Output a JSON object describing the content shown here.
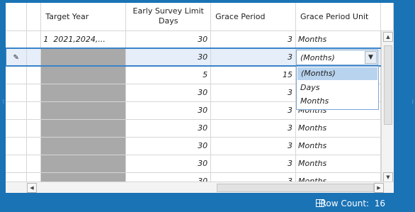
{
  "columns": {
    "target_year": "Target Year",
    "early_survey": "Early Survey Limit Days",
    "grace_period": "Grace Period",
    "grace_unit": "Grace Period Unit"
  },
  "rows": [
    {
      "idx": "1",
      "target_year": "2021,2024,...",
      "early": "30",
      "grace": "3",
      "unit": "Months"
    },
    {
      "idx": "",
      "target_year": "",
      "early": "30",
      "grace": "3",
      "unit": "(Months)",
      "editing": true
    },
    {
      "idx": "",
      "target_year": "",
      "early": "5",
      "grace": "15",
      "unit": ""
    },
    {
      "idx": "",
      "target_year": "",
      "early": "30",
      "grace": "3",
      "unit": ""
    },
    {
      "idx": "",
      "target_year": "",
      "early": "30",
      "grace": "3",
      "unit": "Months"
    },
    {
      "idx": "",
      "target_year": "",
      "early": "30",
      "grace": "3",
      "unit": "Months"
    },
    {
      "idx": "",
      "target_year": "",
      "early": "30",
      "grace": "3",
      "unit": "Months"
    },
    {
      "idx": "",
      "target_year": "",
      "early": "30",
      "grace": "3",
      "unit": "Months"
    },
    {
      "idx": "",
      "target_year": "",
      "early": "30",
      "grace": "3",
      "unit": "Months"
    }
  ],
  "editor": {
    "value": "(Months)"
  },
  "dropdown": {
    "options": [
      "(Months)",
      "Days",
      "Months"
    ],
    "selected": 0
  },
  "status": {
    "row_count_label": "Row Count:",
    "row_count": "16"
  },
  "icons": {
    "edit_indicator": "pencil-icon",
    "row_count": "table-icon"
  },
  "colors": {
    "accent": "#1a73b5",
    "selection": "#e5eef9",
    "dropdown_highlight": "#b8d3ee",
    "gray_cell": "#a9a9a9"
  }
}
